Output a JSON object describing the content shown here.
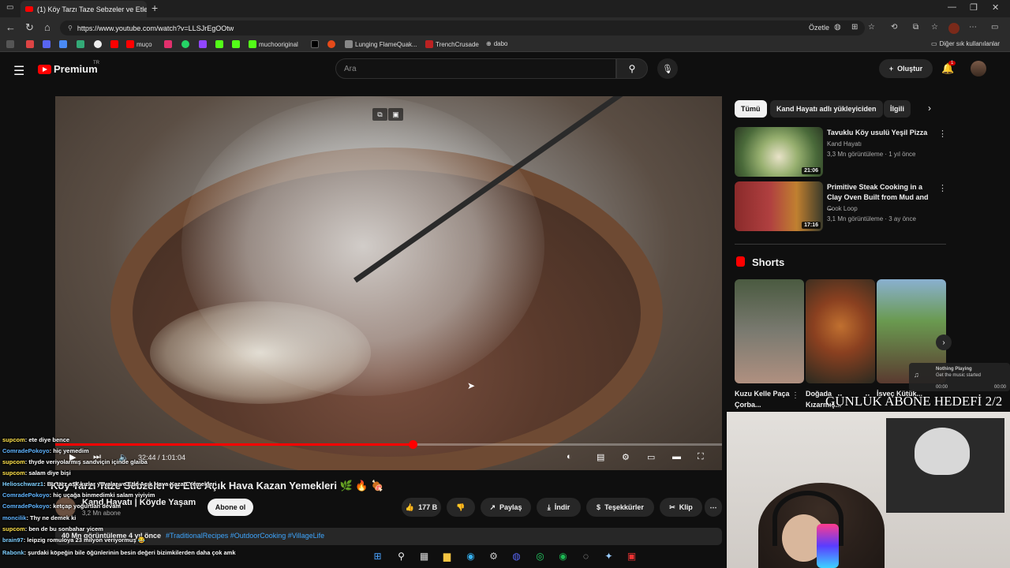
{
  "browser": {
    "tab_title": "(1) Köy Tarzı Taze Sebzeler ve Etle...",
    "url": "https://www.youtube.com/watch?v=LLSJrEgOOtw",
    "summarize_label": "Özetle",
    "other_bookmarks": "Diğer sık kullanılanlar",
    "bookmarks": [
      "muço",
      "muchooriginal",
      "Lunging FlameQuak...",
      "TrenchCrusade",
      "dabo"
    ]
  },
  "yt_header": {
    "brand": "Premium",
    "tr_badge": "TR",
    "search_placeholder": "Ara",
    "create_label": "Oluştur",
    "notif_count": "1"
  },
  "player": {
    "time": "32:44 / 1:01:04",
    "progress_fraction": 0.536
  },
  "video": {
    "title": "Köy Tarzı Taze Sebzeler ve Etle Açık Hava Kazan Yemekleri 🌿 🔥 🍖",
    "channel": "Kand Hayatı | Köyde Yaşam",
    "subs": "3,2 Mn abone",
    "subscribe": "Abone ol",
    "likes": "177 B",
    "share": "Paylaş",
    "download": "İndir",
    "thanks": "Teşekkürler",
    "clip": "Klip",
    "views_date": "40 Mn görüntüleme  4 yıl önce",
    "tags": "#TraditionalRecipes #OutdoorCooking #VillageLife"
  },
  "sidebar": {
    "chips": [
      "Tümü",
      "Kand Hayatı adlı yükleyiciden",
      "İlgili"
    ],
    "recommended": [
      {
        "title": "Tavuklu Köy usulü Yeşil Pizza",
        "channel": "Kand Hayatı",
        "meta": "3,3 Mn görüntüleme · 1 yıl önce",
        "duration": "21:06"
      },
      {
        "title": "Primitive Steak Cooking in a Clay Oven Built from Mud and ...",
        "channel": "Cook Loop",
        "meta": "3,1 Mn görüntüleme · 3 ay önce",
        "duration": "17:16"
      }
    ],
    "shorts_label": "Shorts",
    "shorts": [
      {
        "title": "Kuzu Kelle Paça Çorba..."
      },
      {
        "title": "Doğada Kızarmış..."
      },
      {
        "title": "İsveç Kütük..."
      }
    ]
  },
  "overlay": {
    "goal_text": "GÜNLÜK ABONE HEDEFİ 2/2",
    "music_title": "Nothing Playing",
    "music_sub": "Get the music started",
    "music_time_start": "00:00",
    "music_time_end": "00:00"
  },
  "chat": [
    {
      "user": "supcom",
      "msg": ": ete diye bence"
    },
    {
      "user": "ComradePokoyo",
      "msg": ": hiç yemedim"
    },
    {
      "user": "supcom",
      "msg": ": thyde veriyolarmış sandviçin içinde glaiba"
    },
    {
      "user": "supcom",
      "msg": ": salam diye bişi"
    },
    {
      "user": "Helioschwarz1",
      "msg": ": Bu tarz aşk kızlar yuvalar ve Etle Açık Hava Kazan Yemekleri"
    },
    {
      "user": "ComradePokoyo",
      "msg": ": hiç uçağa binmedimki salam yiyiyim"
    },
    {
      "user": "ComradePokoyo",
      "msg": ": ketçap yoğurtlan devam"
    },
    {
      "user": "moncilik",
      "msg": ": Thy ne demek ki"
    },
    {
      "user": "supcom",
      "msg": ": ben de bu sonbahar yicem"
    },
    {
      "user": "brain97",
      "msg": ": leipzig romuloya 23 milyon veriyormuş 😂"
    },
    {
      "user": "Rabonk",
      "msg": ": şurdaki köpeğin bile öğünlerinin besin değeri bizimkilerden daha çok amk"
    }
  ]
}
